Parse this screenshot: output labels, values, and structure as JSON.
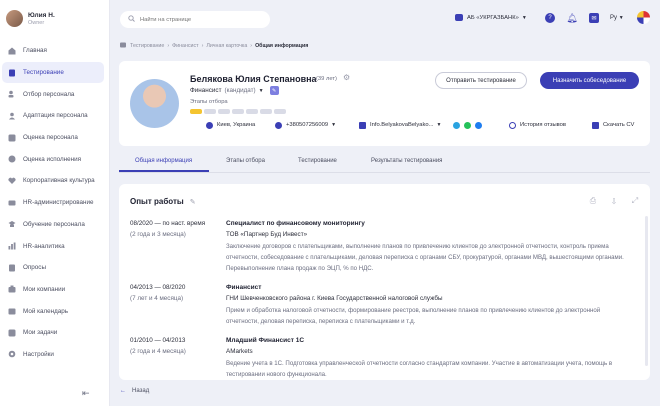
{
  "user": {
    "name": "Юлия Н.",
    "role": "Owner"
  },
  "sidebar": {
    "items": [
      {
        "label": "Главная",
        "icon": "home-icon"
      },
      {
        "label": "Тестирование",
        "icon": "test-icon",
        "active": true
      },
      {
        "label": "Отбор персонала",
        "icon": "people-icon"
      },
      {
        "label": "Адаптация персонала",
        "icon": "adapt-icon"
      },
      {
        "label": "Оценка персонала",
        "icon": "grade-icon"
      },
      {
        "label": "Оценка исполнения",
        "icon": "check-icon"
      },
      {
        "label": "Корпоративная культура",
        "icon": "culture-icon"
      },
      {
        "label": "HR-администрирование",
        "icon": "admin-icon"
      },
      {
        "label": "Обучение персонала",
        "icon": "education-icon"
      },
      {
        "label": "HR-аналитика",
        "icon": "analytics-icon"
      },
      {
        "label": "Опросы",
        "icon": "survey-icon"
      },
      {
        "label": "Мои компании",
        "icon": "company-icon"
      },
      {
        "label": "Мой календарь",
        "icon": "calendar-icon"
      },
      {
        "label": "Мои задачи",
        "icon": "tasks-icon"
      },
      {
        "label": "Настройки",
        "icon": "settings-icon"
      }
    ],
    "collapse_glyph": "⇤"
  },
  "topbar": {
    "search_placeholder": "Найти на странице",
    "company": "АБ «УКРГАЗБАНК»",
    "language": "Ру"
  },
  "breadcrumb": [
    "Тестирование",
    "Финансист",
    "Личная карточка",
    "Общая информация"
  ],
  "profile": {
    "name": "Белякова Юлия Степановна",
    "age": "(39 лет)",
    "position": "Финансист",
    "position_status": "(кандидат)",
    "stages_label": "Этапы отбора",
    "city": "Киев, Украина",
    "phone": "+380507256009",
    "email": "Info.BelyakovaBelyako...",
    "history": "История отзывов",
    "download": "Скачать CV",
    "send_test": "Отправить тестирование",
    "schedule_interview": "Назначить собеседование"
  },
  "tabs": [
    "Общая информация",
    "Этапы отбора",
    "Тестирование",
    "Результаты тестирования"
  ],
  "experience": {
    "title": "Опыт работы",
    "jobs": [
      {
        "period": "08/2020 — по наст. время",
        "duration": "(2 года и 3 месяца)",
        "title": "Специалист по финансовому мониторингу",
        "company": "ТОВ «Партнер Буд Инвест»",
        "description": "Заключение договоров с плательщиками, выполнение планов по привлечению клиентов до электронной отчетности, контроль приема отчетности, собеседование с плательщиками, деловая переписка с органами СБУ, прокуратурой, органами МВД, вышестоящими органами. Перевыполнение плана продаж по ЭЦП, % по НДС."
      },
      {
        "period": "04/2013 — 08/2020",
        "duration": "(7 лет и 4 месяца)",
        "title": "Финансист",
        "company": "ГНИ Шевченковского района г. Киева Государственной налоговой службы",
        "description": "Прием и обработка налоговой отчетности, формирование реестров, выполнение планов по привлечению клиентов до электронной отчетности, деловая переписка, переписка с плательщиками и т.д."
      },
      {
        "period": "01/2010 — 04/2013",
        "duration": "(2 года и 4 месяца)",
        "title": "Младший Финансист 1С",
        "company": "AMarkets",
        "description": "Ведение учета в 1С. Подготовка управленческой отчетности согласно стандартам компании. Участие в автоматизации учета, помощь в тестировании нового функционала."
      }
    ]
  },
  "footer": {
    "back": "Назад"
  },
  "colors": {
    "accent": "#3b3fb5",
    "stage_done": "#f4c430",
    "background": "#eef0f7"
  }
}
